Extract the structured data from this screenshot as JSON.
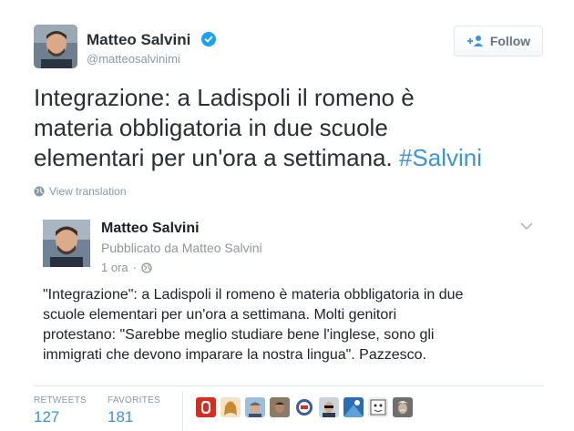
{
  "tweet": {
    "author_name": "Matteo Salvini",
    "author_handle": "@matteosalvinimi",
    "follow_label": "Follow",
    "text_lines": [
      "Integrazione: a Ladispoli il romeno è",
      "materia obbligatoria in due scuole",
      "elementari per un'ora a settimana. "
    ],
    "hashtag": "#Salvini",
    "view_translation": "View translation",
    "colors": {
      "link": "#3b94d9",
      "verified": "#1da1f2",
      "muted": "#8899a6"
    }
  },
  "embedded_post": {
    "name": "Matteo Salvini",
    "published_by": "Pubblicato da Matteo Salvini",
    "time": "1 ora",
    "dot": "·",
    "text_lines": [
      "\"Integrazione\": a Ladispoli il romeno è materia obbligatoria in due",
      "scuole elementari per un'ora a settimana. Molti genitori",
      "protestano: \"Sarebbe meglio studiare bene l'inglese, sono gli",
      "immigrati che devono imparare la nostra lingua\". Pazzesco."
    ]
  },
  "stats": {
    "retweets_label": "RETWEETS",
    "retweets_value": "127",
    "favorites_label": "FAVORITES",
    "favorites_value": "181"
  },
  "favoriter_avatars": [
    {
      "name": "avatar-red-logo",
      "color": "#d62d20"
    },
    {
      "name": "avatar-woman",
      "color": "#c89b5a"
    },
    {
      "name": "avatar-man-cap",
      "color": "#7aa0c4"
    },
    {
      "name": "avatar-man-dark",
      "color": "#5a4a3a"
    },
    {
      "name": "avatar-badge",
      "color": "#3c5aa0"
    },
    {
      "name": "avatar-man-sunglasses",
      "color": "#2c3e50"
    },
    {
      "name": "avatar-blue-pattern",
      "color": "#2a6db0"
    },
    {
      "name": "avatar-cartoon",
      "color": "#8a8a8a"
    },
    {
      "name": "avatar-einstein",
      "color": "#b0b0b0"
    }
  ]
}
